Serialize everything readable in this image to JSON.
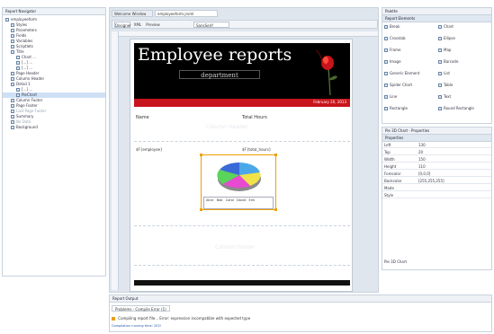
{
  "left_panel": {
    "title": "Report Navigator",
    "tree": [
      {
        "label": "employeeform",
        "indent": 0
      },
      {
        "label": "Styles",
        "indent": 1
      },
      {
        "label": "Parameters",
        "indent": 1
      },
      {
        "label": "Fields",
        "indent": 1
      },
      {
        "label": "Variables",
        "indent": 1
      },
      {
        "label": "Scriptlets",
        "indent": 1
      },
      {
        "label": "Title",
        "indent": 1
      },
      {
        "label": "Chart ...",
        "indent": 2
      },
      {
        "label": "[...] ...",
        "indent": 2
      },
      {
        "label": "[...] ...",
        "indent": 2
      },
      {
        "label": "Page Header",
        "indent": 1
      },
      {
        "label": "Column Header",
        "indent": 1
      },
      {
        "label": "Detail 1",
        "indent": 1
      },
      {
        "label": "[...] ...",
        "indent": 2
      },
      {
        "label": "PieChart",
        "indent": 2,
        "selected": true
      },
      {
        "label": "Column Footer",
        "indent": 1
      },
      {
        "label": "Page Footer",
        "indent": 1
      },
      {
        "label": "Last Page Footer",
        "indent": 1,
        "muted": true
      },
      {
        "label": "Summary",
        "indent": 1
      },
      {
        "label": "No Data",
        "indent": 1,
        "muted": true
      },
      {
        "label": "Background",
        "indent": 1
      }
    ]
  },
  "editor": {
    "tabs": [
      "Welcome Window",
      "employeeform.jrxml"
    ],
    "view_tabs": [
      "Designer",
      "XML",
      "Preview"
    ],
    "font_name": "SansSerif"
  },
  "report": {
    "title": "Employee reports",
    "subtitle": "department",
    "date": "February 20, 2013",
    "column_labels": [
      "Name",
      "Total Hours"
    ],
    "detail_labels": [
      "$F{employee}",
      "$F{total_hours}"
    ],
    "band_labels": [
      "Column Header",
      "Column Footer"
    ],
    "chart_legend": [
      "Alice",
      "Bob",
      "Carol",
      "David",
      "Erik"
    ]
  },
  "output": {
    "panel_title": "Report Output",
    "tab": "Problems - Compile Error (1)",
    "message": "Compiling report file... Error: expression incompatible with expected type",
    "status": "Compilation running time: 203!"
  },
  "palette": {
    "title": "Palette",
    "section": "Report Elements",
    "items_left": [
      "Break",
      "Crosstab",
      "Frame",
      "Image",
      "Generic Element",
      "Spider Chart",
      "Line",
      "Rectangle"
    ],
    "items_right": [
      "Chart",
      "Ellipse",
      "Map",
      "Barcode",
      "List",
      "Table",
      "Text",
      "Round Rectangle"
    ]
  },
  "properties": {
    "title": "Pie 3D Chart - Properties",
    "section": "Properties",
    "rows": [
      {
        "key": "Left",
        "value": "130"
      },
      {
        "key": "Top",
        "value": "20"
      },
      {
        "key": "Width",
        "value": "150"
      },
      {
        "key": "Height",
        "value": "110"
      },
      {
        "key": "Forecolor",
        "value": "[0,0,0]"
      },
      {
        "key": "Backcolor",
        "value": "[255,255,255]"
      },
      {
        "key": "Mode",
        "value": ""
      },
      {
        "key": "Style",
        "value": ""
      }
    ],
    "footer": "Pie 3D Chart"
  },
  "colors": {
    "accent": "#c8141c",
    "header_bg": "#000000",
    "selection": "#f0a000"
  }
}
